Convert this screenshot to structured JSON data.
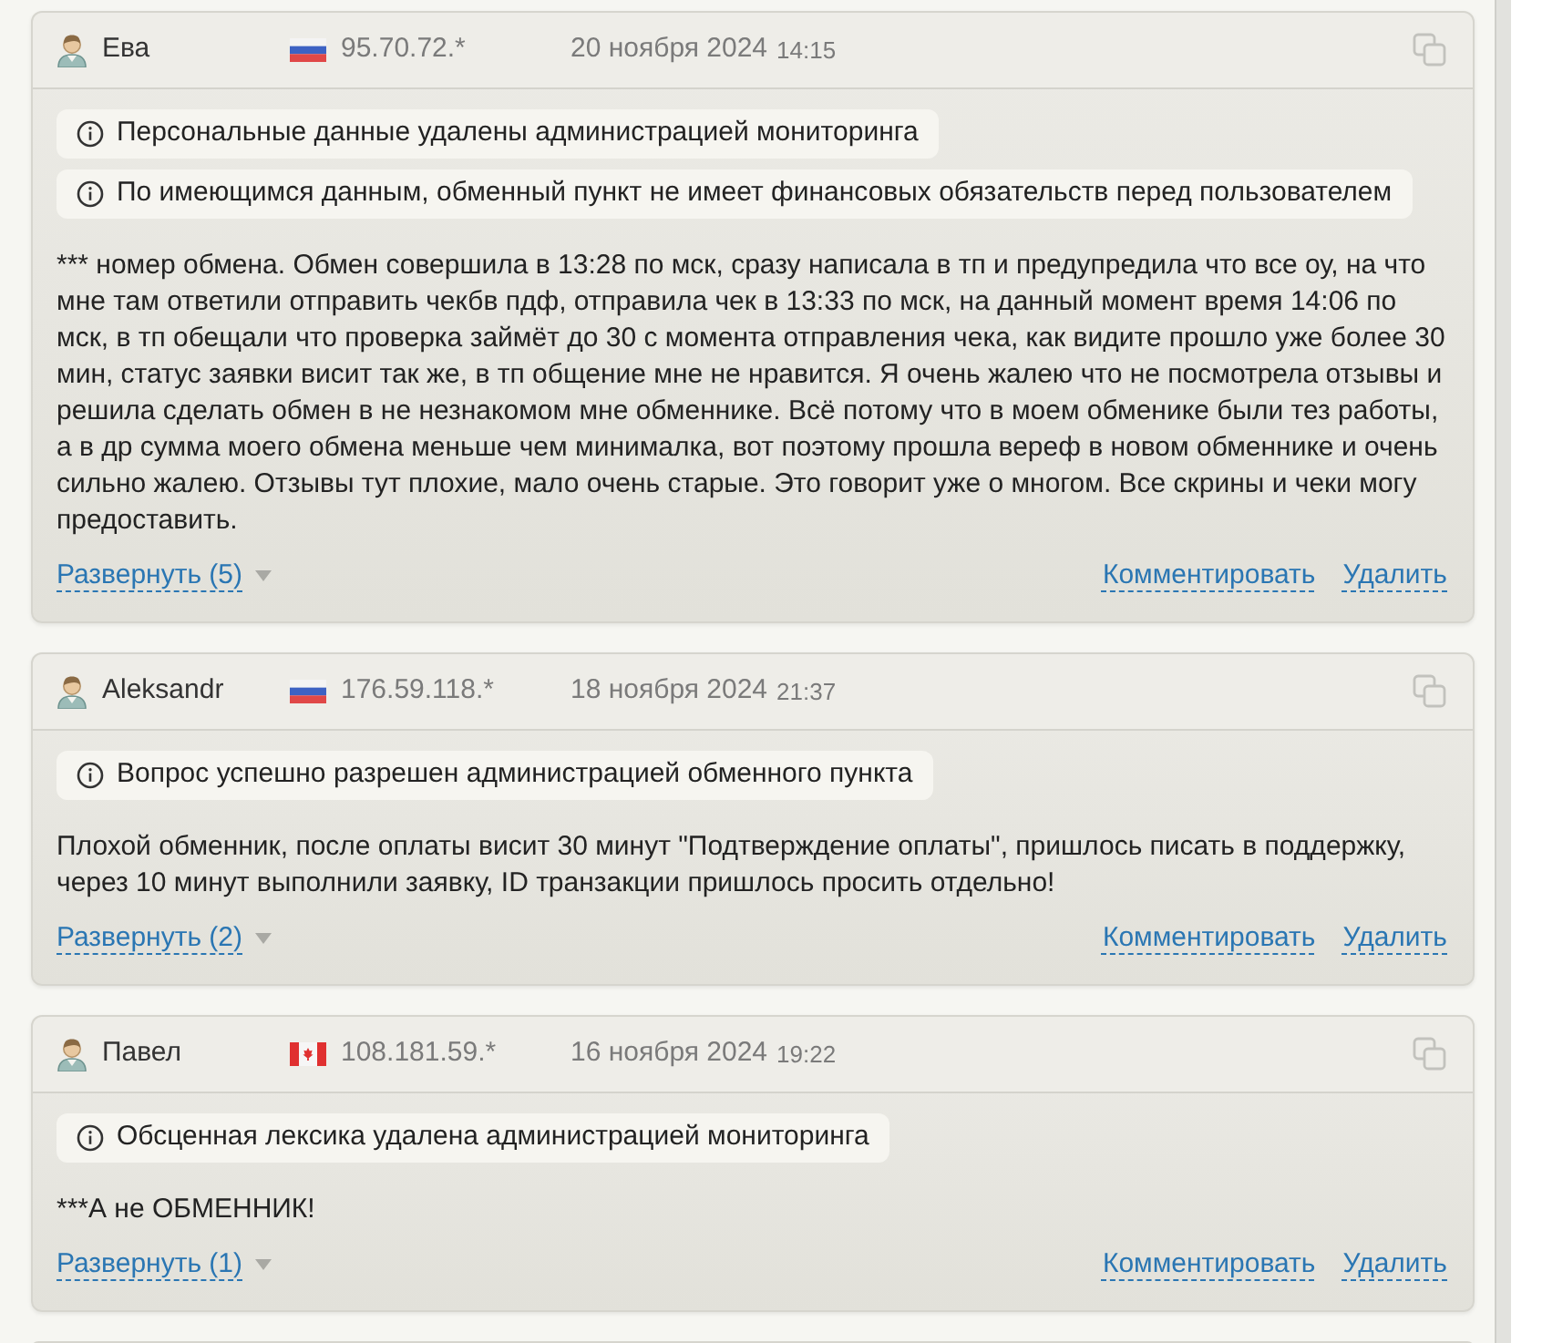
{
  "reviews": [
    {
      "author": "Ева",
      "flag": {
        "kind": "ru"
      },
      "ip": "95.70.72.*",
      "date": "20 ноября 2024",
      "time": "14:15",
      "notices": [
        "Персональные данные удалены администрацией мониторинга",
        "По имеющимся данным, обменный пункт не имеет финансовых обязательств перед пользователем"
      ],
      "text": "*** номер обмена. Обмен совершила в 13:28 по мск, сразу написала в тп и предупредила что все оу, на что мне там ответили отправить чекбв пдф, отправила чек в 13:33 по мск, на данный момент время 14:06 по мск, в тп обещали что проверка займёт до 30 с момента отправления чека, как видите прошло уже более 30 мин, статус заявки висит так же, в тп общение мне не нравится. Я очень жалею что не посмотрела отзывы и решила сделать обмен в не незнакомом мне обменнике. Всё потому что в моем обменике были тез работы, а в др сумма моего обмена меньше чем минималка, вот поэтому прошла вереф в новом обменнике и очень сильно жалею. Отзывы тут плохие, мало очень старые. Это говорит уже о многом. Все скрины и чеки могу предоставить.",
      "expand": "Развернуть (5)",
      "actions": [
        "Комментировать",
        "Удалить"
      ]
    },
    {
      "author": "Aleksandr",
      "flag": {
        "kind": "ru"
      },
      "ip": "176.59.118.*",
      "date": "18 ноября 2024",
      "time": "21:37",
      "notices": [
        "Вопрос успешно разрешен администрацией обменного пункта"
      ],
      "text": "Плохой обменник, после оплаты висит 30 минут \"Подтверждение оплаты\", пришлось писать в поддержку, через 10 минут выполнили заявку, ID транзакции пришлось просить отдельно!",
      "expand": "Развернуть (2)",
      "actions": [
        "Комментировать",
        "Удалить"
      ]
    },
    {
      "author": "Павел",
      "flag": {
        "kind": "ca"
      },
      "ip": "108.181.59.*",
      "date": "16 ноября 2024",
      "time": "19:22",
      "notices": [
        "Обсценная лексика удалена администрацией мониторинга"
      ],
      "text": "***А не ОБМЕННИК!",
      "expand": "Развернуть (1)",
      "actions": [
        "Комментировать",
        "Удалить"
      ]
    }
  ]
}
